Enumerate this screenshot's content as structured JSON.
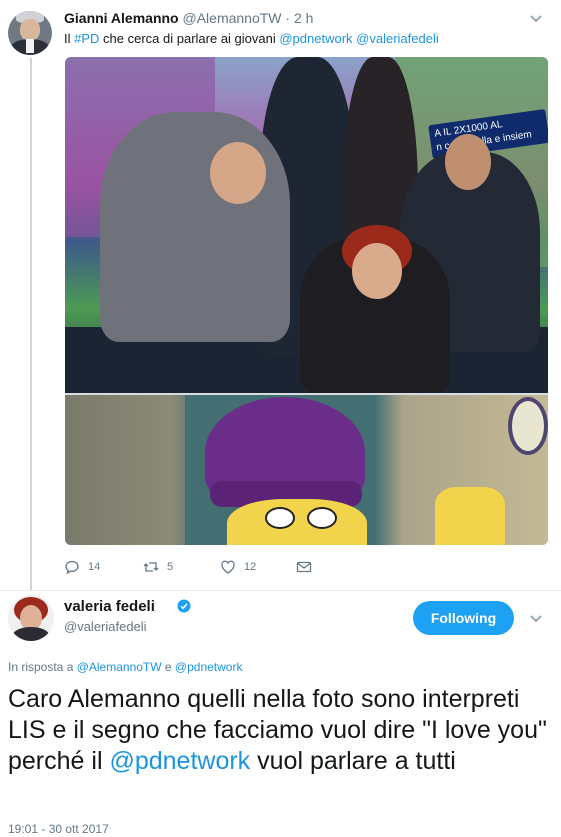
{
  "tweet1": {
    "name": "Gianni Alemanno",
    "handle": "@AlemannoTW",
    "separator": "·",
    "time": "2 h",
    "text_prefix": "Il ",
    "hashtag": "#PD",
    "text_middle": " che cerca di parlare ai giovani ",
    "mention1": "@pdnetwork",
    "mention2": "@valeriafedeli",
    "photo_banner_line1": "A IL 2X1000 AL",
    "photo_banner_line2": "n costa nulla e insiem",
    "actions": {
      "replies": "14",
      "retweets": "5",
      "likes": "12"
    }
  },
  "tweet2": {
    "name": "valeria fedeli",
    "handle": "@valeriafedeli",
    "follow_label": "Following",
    "in_reply_prefix": "In risposta a ",
    "in_reply_mention1": "@AlemannoTW",
    "in_reply_conj": " e ",
    "in_reply_mention2": "@pdnetwork",
    "text_part1": "Caro Alemanno quelli nella foto sono interpreti LIS e il segno che facciamo vuol dire \"I love you\" perché il ",
    "text_mention": "@pdnetwork",
    "text_part2": " vuol parlare a tutti",
    "timestamp": "19:01 - 30 ott 2017"
  },
  "icons": {
    "chevron": "chevron-down-icon",
    "reply": "reply-icon",
    "retweet": "retweet-icon",
    "like": "heart-icon",
    "dm": "envelope-icon",
    "verified": "verified-badge-icon"
  },
  "colors": {
    "link": "#1b95e0",
    "follow_button": "#1da1f2",
    "muted_text": "#657786"
  }
}
